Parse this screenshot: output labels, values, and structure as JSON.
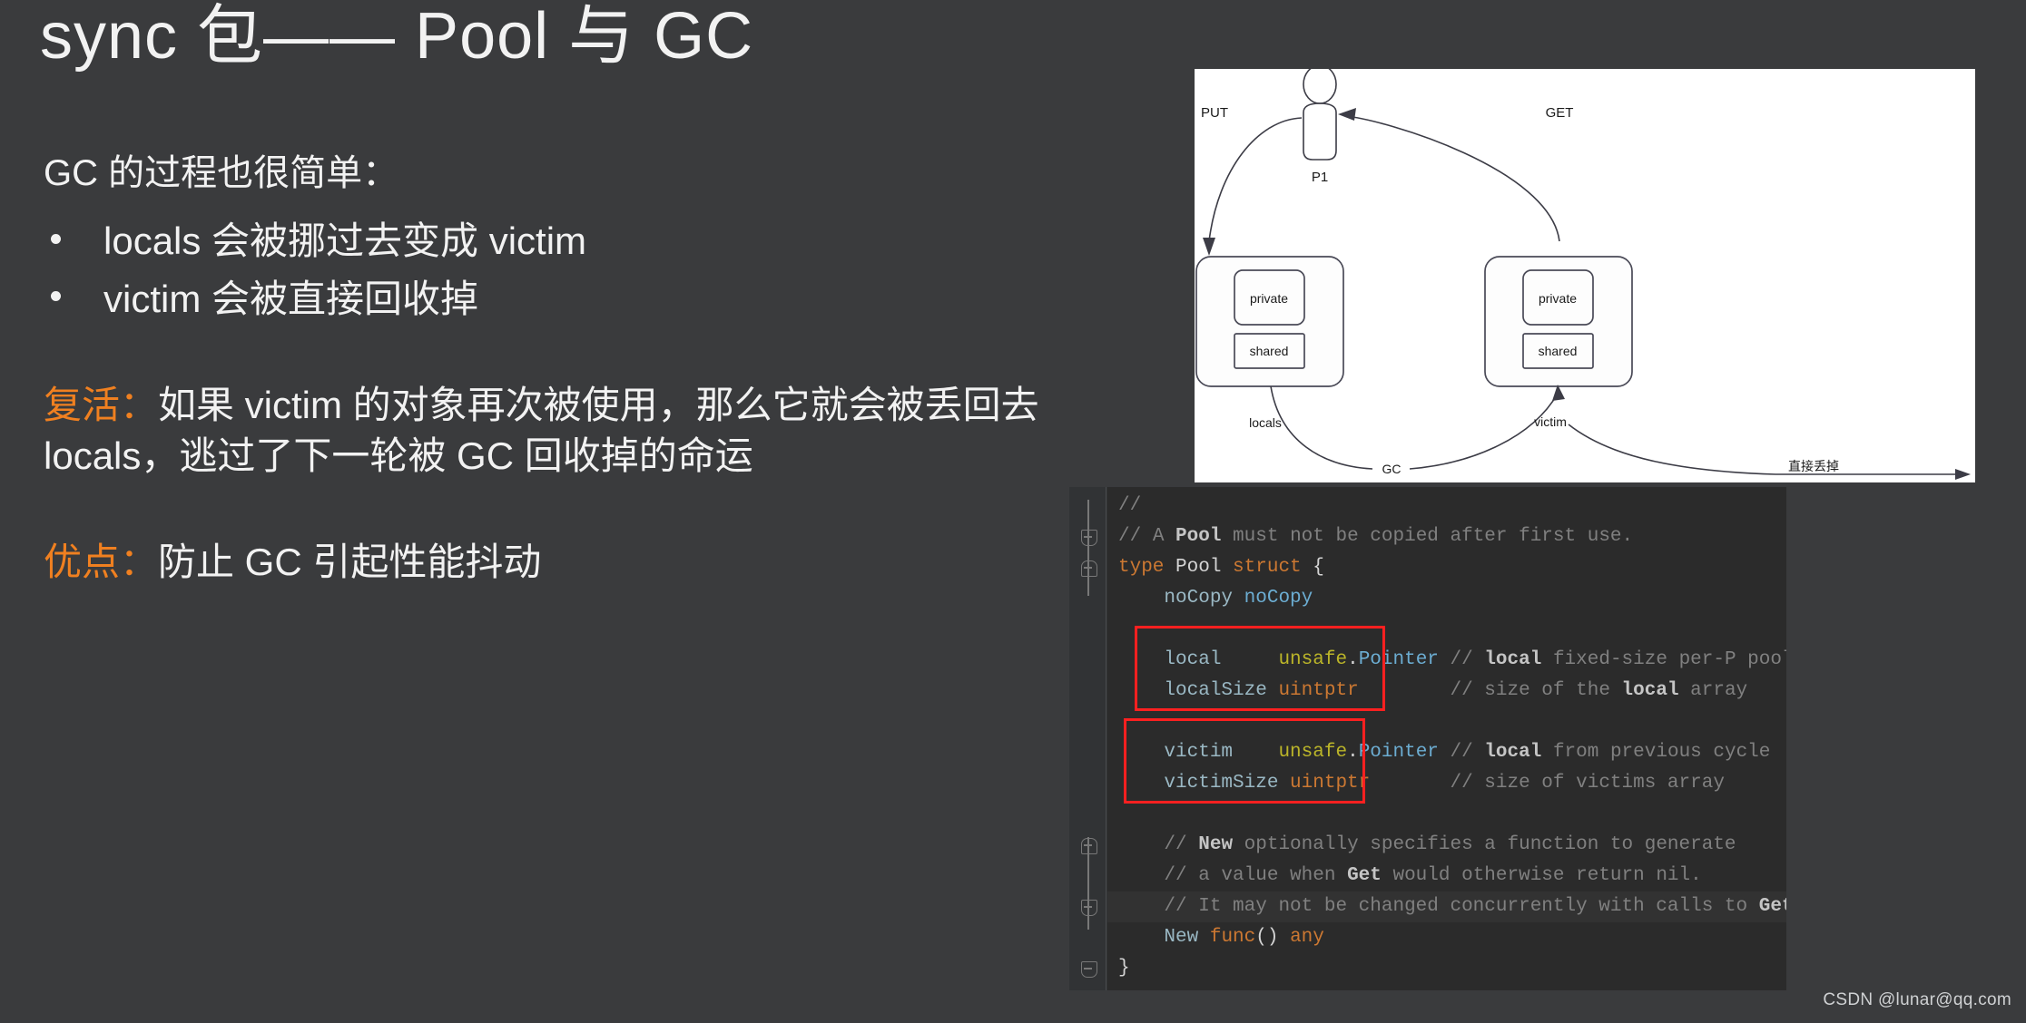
{
  "slide": {
    "title": "sync 包—— Pool 与 GC",
    "background_color": "#3a3b3d",
    "accent_color": "#f08020",
    "text_color": "#f2f2f2"
  },
  "content": {
    "lead": "GC 的过程也很简单：",
    "bullets": [
      {
        "text": "locals 会被挪过去变成 victim"
      },
      {
        "text": "victim 会被直接回收掉"
      }
    ],
    "resurrect": {
      "label": "复活：",
      "body": "如果 victim 的对象再次被使用，那么它就会被丢回去 locals，逃过了下一轮被 GC 回收掉的命运"
    },
    "merit": {
      "label": "优点：",
      "body": "防止 GC 引起性能抖动"
    }
  },
  "diagram": {
    "actor_label": "P1",
    "edge_put": "PUT",
    "edge_get": "GET",
    "edge_locals": "locals",
    "edge_gc": "GC",
    "edge_victim": "victim",
    "edge_discard": "直接丢掉",
    "pool_left": {
      "private": "private",
      "shared": "shared"
    },
    "pool_right": {
      "private": "private",
      "shared": "shared"
    }
  },
  "code": {
    "lines": [
      {
        "id": "l1",
        "indent": 0,
        "fold": null,
        "highlight": false,
        "tokens": [
          {
            "t": "// ",
            "c": "c-com"
          }
        ]
      },
      {
        "id": "l2",
        "indent": 0,
        "fold": "minus",
        "highlight": false,
        "tokens": [
          {
            "t": "// ",
            "c": "c-com"
          },
          {
            "t": "A ",
            "c": "c-com"
          },
          {
            "t": "Pool",
            "c": "c-com-b"
          },
          {
            "t": " must not be copied after first use.",
            "c": "c-com"
          }
        ]
      },
      {
        "id": "l3",
        "indent": 0,
        "fold": "plus",
        "highlight": false,
        "tokens": [
          {
            "t": "type ",
            "c": "c-kw"
          },
          {
            "t": "Pool ",
            "c": "c-white"
          },
          {
            "t": "struct ",
            "c": "c-kw"
          },
          {
            "t": "{",
            "c": "c-white"
          }
        ]
      },
      {
        "id": "l4",
        "indent": 1,
        "fold": null,
        "highlight": false,
        "tokens": [
          {
            "t": "noCopy ",
            "c": "c-ident"
          },
          {
            "t": "noCopy",
            "c": "c-cls"
          }
        ]
      },
      {
        "id": "l5",
        "indent": 0,
        "fold": null,
        "highlight": false,
        "tokens": []
      },
      {
        "id": "l6",
        "indent": 1,
        "fold": null,
        "highlight": false,
        "tokens": [
          {
            "t": "local     ",
            "c": "c-ident"
          },
          {
            "t": "unsafe",
            "c": "c-pkg"
          },
          {
            "t": ".",
            "c": "c-white"
          },
          {
            "t": "Pointer ",
            "c": "c-cls"
          },
          {
            "t": "// ",
            "c": "c-com"
          },
          {
            "t": "local",
            "c": "c-com-b"
          },
          {
            "t": " fixed-size per-P pool,",
            "c": "c-com"
          }
        ]
      },
      {
        "id": "l7",
        "indent": 1,
        "fold": null,
        "highlight": false,
        "tokens": [
          {
            "t": "localSize ",
            "c": "c-ident"
          },
          {
            "t": "uintptr",
            "c": "c-kw"
          },
          {
            "t": "        // ",
            "c": "c-com"
          },
          {
            "t": "size of the ",
            "c": "c-com"
          },
          {
            "t": "local",
            "c": "c-com-b"
          },
          {
            "t": " array",
            "c": "c-com"
          }
        ]
      },
      {
        "id": "l8",
        "indent": 0,
        "fold": null,
        "highlight": false,
        "tokens": []
      },
      {
        "id": "l9",
        "indent": 1,
        "fold": null,
        "highlight": false,
        "tokens": [
          {
            "t": "victim    ",
            "c": "c-ident"
          },
          {
            "t": "unsafe",
            "c": "c-pkg"
          },
          {
            "t": ".",
            "c": "c-white"
          },
          {
            "t": "Pointer ",
            "c": "c-cls"
          },
          {
            "t": "// ",
            "c": "c-com"
          },
          {
            "t": "local",
            "c": "c-com-b"
          },
          {
            "t": " from previous cycle",
            "c": "c-com"
          }
        ]
      },
      {
        "id": "l10",
        "indent": 1,
        "fold": null,
        "highlight": false,
        "tokens": [
          {
            "t": "victimSize ",
            "c": "c-ident"
          },
          {
            "t": "uintptr",
            "c": "c-kw"
          },
          {
            "t": "       // ",
            "c": "c-com"
          },
          {
            "t": "size of victims array",
            "c": "c-com"
          }
        ]
      },
      {
        "id": "l11",
        "indent": 0,
        "fold": null,
        "highlight": false,
        "tokens": []
      },
      {
        "id": "l12",
        "indent": 1,
        "fold": "plus",
        "highlight": false,
        "tokens": [
          {
            "t": "// ",
            "c": "c-com"
          },
          {
            "t": "New",
            "c": "c-com-b"
          },
          {
            "t": " optionally specifies a function to generate",
            "c": "c-com"
          }
        ]
      },
      {
        "id": "l13",
        "indent": 1,
        "fold": null,
        "highlight": false,
        "tokens": [
          {
            "t": "// a value when ",
            "c": "c-com"
          },
          {
            "t": "Get",
            "c": "c-com-b"
          },
          {
            "t": " would otherwise return nil.",
            "c": "c-com"
          }
        ]
      },
      {
        "id": "l14",
        "indent": 1,
        "fold": "minus",
        "highlight": true,
        "tokens": [
          {
            "t": "// It may not be changed concurrently with calls to ",
            "c": "c-com"
          },
          {
            "t": "Get",
            "c": "c-com-b"
          },
          {
            "t": ".",
            "c": "c-com"
          }
        ]
      },
      {
        "id": "l15",
        "indent": 1,
        "fold": null,
        "highlight": false,
        "tokens": [
          {
            "t": "New ",
            "c": "c-ident"
          },
          {
            "t": "func",
            "c": "c-kw"
          },
          {
            "t": "() ",
            "c": "c-white"
          },
          {
            "t": "any",
            "c": "c-kw"
          }
        ]
      },
      {
        "id": "l16",
        "indent": 0,
        "fold": "minus",
        "highlight": false,
        "tokens": [
          {
            "t": "}",
            "c": "c-white"
          }
        ]
      }
    ]
  },
  "watermark": "CSDN @lunar@qq.com"
}
